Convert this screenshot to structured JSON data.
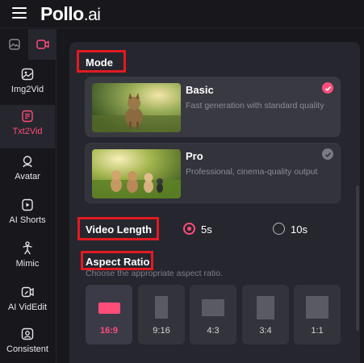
{
  "app": {
    "logo_main": "Pollo",
    "logo_suffix": ".ai"
  },
  "sidebar": {
    "tabs": [
      {
        "icon": "image-icon",
        "active": false
      },
      {
        "icon": "video-icon",
        "active": true
      }
    ],
    "items": [
      {
        "label": "Img2Vid",
        "icon": "image-to-video-icon",
        "active": false
      },
      {
        "label": "Txt2Vid",
        "icon": "text-to-video-icon",
        "active": true
      },
      {
        "label": "Avatar",
        "icon": "avatar-icon",
        "active": false
      },
      {
        "label": "AI Shorts",
        "icon": "shorts-icon",
        "active": false
      },
      {
        "label": "Mimic",
        "icon": "mimic-icon",
        "active": false
      },
      {
        "label": "AI VidEdit",
        "icon": "video-edit-icon",
        "active": false
      },
      {
        "label": "Consistent",
        "icon": "consistent-icon",
        "active": false
      }
    ]
  },
  "mode": {
    "label": "Mode",
    "options": [
      {
        "title": "Basic",
        "desc": "Fast generation with standard quality",
        "selected": true
      },
      {
        "title": "Pro",
        "desc": "Professional, cinema-quality output",
        "selected": false
      }
    ]
  },
  "video_length": {
    "label": "Video Length",
    "options": [
      {
        "label": "5s",
        "selected": true
      },
      {
        "label": "10s",
        "selected": false
      }
    ]
  },
  "aspect_ratio": {
    "label": "Aspect Ratio",
    "hint": "Choose the appropriate aspect ratio.",
    "options": [
      {
        "label": "16:9",
        "selected": true
      },
      {
        "label": "9:16",
        "selected": false
      },
      {
        "label": "4:3",
        "selected": false
      },
      {
        "label": "3:4",
        "selected": false
      },
      {
        "label": "1:1",
        "selected": false
      }
    ]
  },
  "colors": {
    "accent": "#ff4d79",
    "highlight_box": "#e11b22",
    "background": "#17171c",
    "panel": "#26262e"
  }
}
